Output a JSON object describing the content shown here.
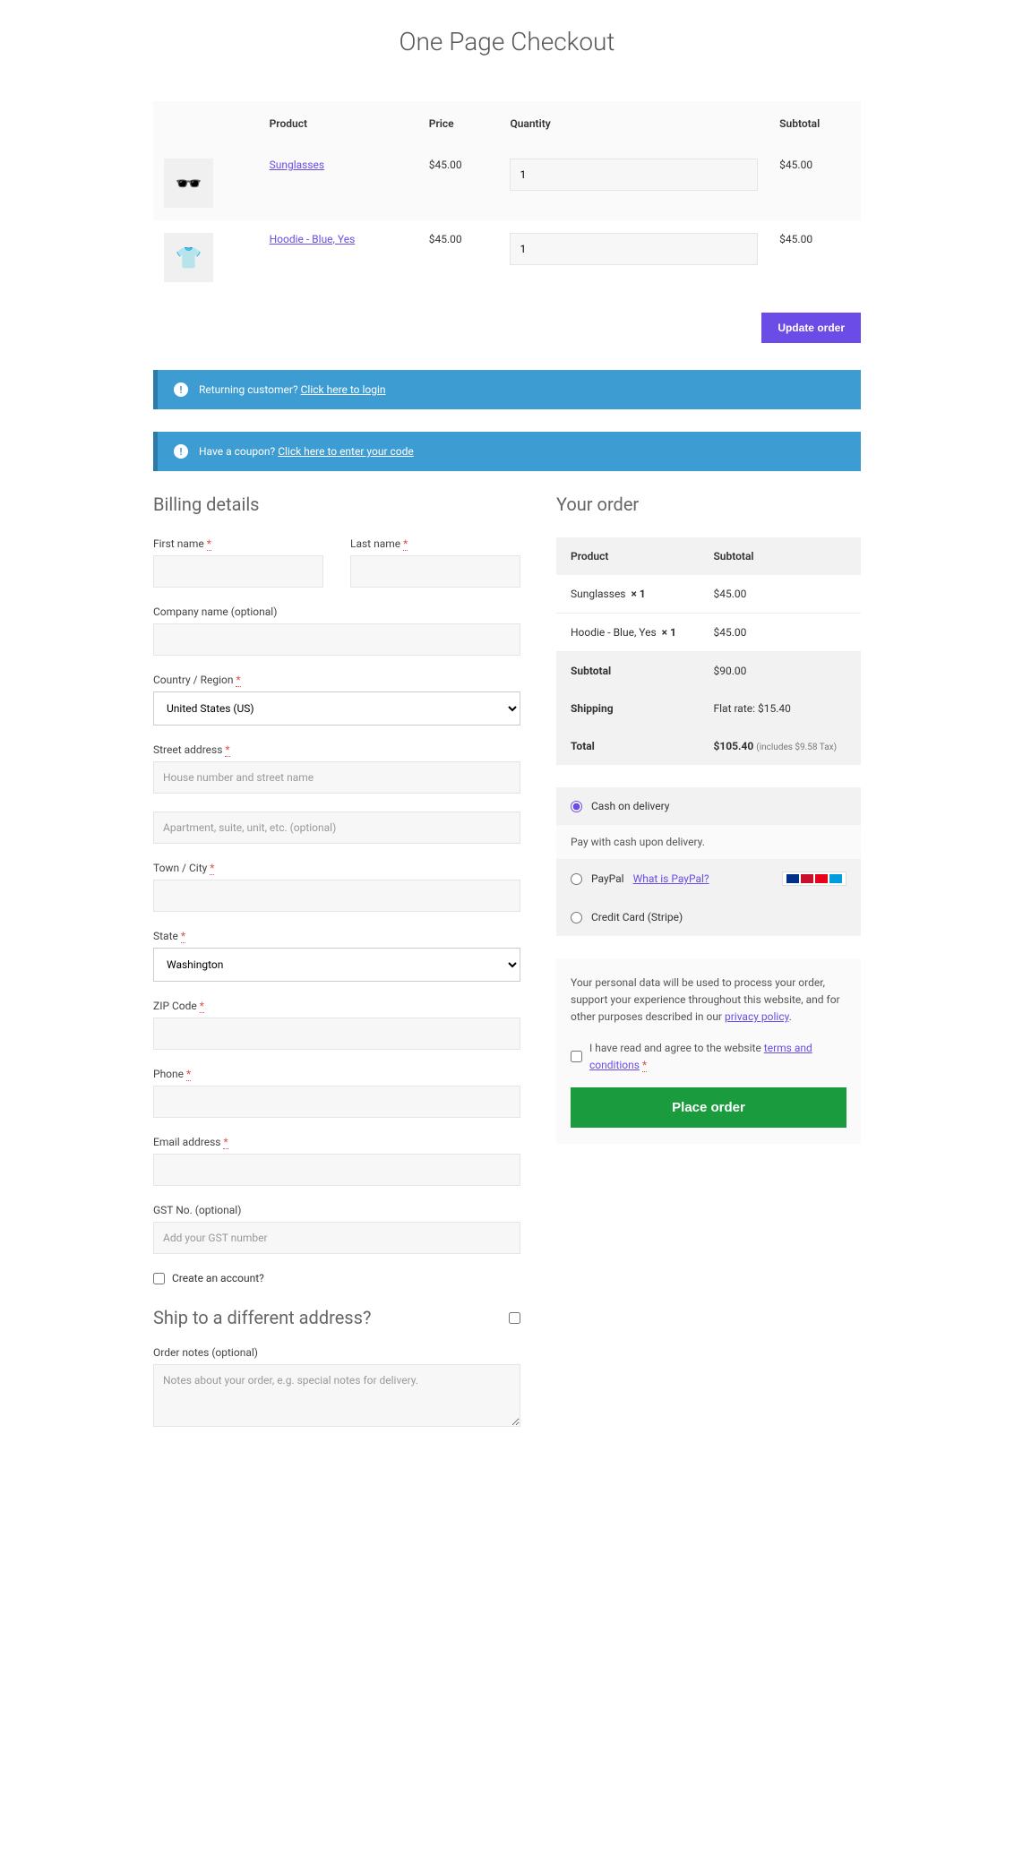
{
  "title": "One Page Checkout",
  "cart_headers": {
    "product": "Product",
    "price": "Price",
    "quantity": "Quantity",
    "subtotal": "Subtotal"
  },
  "cart_items": [
    {
      "name": "Sunglasses",
      "price": "$45.00",
      "qty": "1",
      "subtotal": "$45.00",
      "icon": "🕶️"
    },
    {
      "name": "Hoodie - Blue, Yes",
      "price": "$45.00",
      "qty": "1",
      "subtotal": "$45.00",
      "icon": "👕"
    }
  ],
  "update_btn": "Update order",
  "notice1": {
    "text": "Returning customer?",
    "link": "Click here to login"
  },
  "notice2": {
    "text": "Have a coupon?",
    "link": "Click here to enter your code"
  },
  "billing": {
    "title": "Billing details",
    "first_name": "First name",
    "last_name": "Last name",
    "company": "Company name (optional)",
    "country": "Country / Region",
    "country_val": "United States (US)",
    "street": "Street address",
    "street_ph": "House number and street name",
    "street2_ph": "Apartment, suite, unit, etc. (optional)",
    "city": "Town / City",
    "state": "State",
    "state_val": "Washington",
    "zip": "ZIP Code",
    "phone": "Phone",
    "email": "Email address",
    "gst": "GST No. (optional)",
    "gst_ph": "Add your GST number",
    "create_account": "Create an account?"
  },
  "ship": {
    "title": "Ship to a different address?",
    "notes_label": "Order notes (optional)",
    "notes_ph": "Notes about your order, e.g. special notes for delivery."
  },
  "order": {
    "title": "Your order",
    "th_product": "Product",
    "th_subtotal": "Subtotal",
    "items": [
      {
        "name": "Sunglasses",
        "qty": "× 1",
        "subtotal": "$45.00"
      },
      {
        "name": "Hoodie - Blue, Yes",
        "qty": "× 1",
        "subtotal": "$45.00"
      }
    ],
    "subtotal_label": "Subtotal",
    "subtotal": "$90.00",
    "shipping_label": "Shipping",
    "shipping": "Flat rate: $15.40",
    "total_label": "Total",
    "total": "$105.40",
    "tax_note": "(includes $9.58 Tax)"
  },
  "payment": {
    "cod": "Cash on delivery",
    "cod_desc": "Pay with cash upon delivery.",
    "paypal": "PayPal",
    "paypal_link": "What is PayPal?",
    "stripe": "Credit Card (Stripe)"
  },
  "privacy": {
    "text": "Your personal data will be used to process your order, support your experience throughout this website, and for other purposes described in our ",
    "link": "privacy policy",
    "terms_text": "I have read and agree to the website ",
    "terms_link": "terms and conditions"
  },
  "place_order": "Place order"
}
